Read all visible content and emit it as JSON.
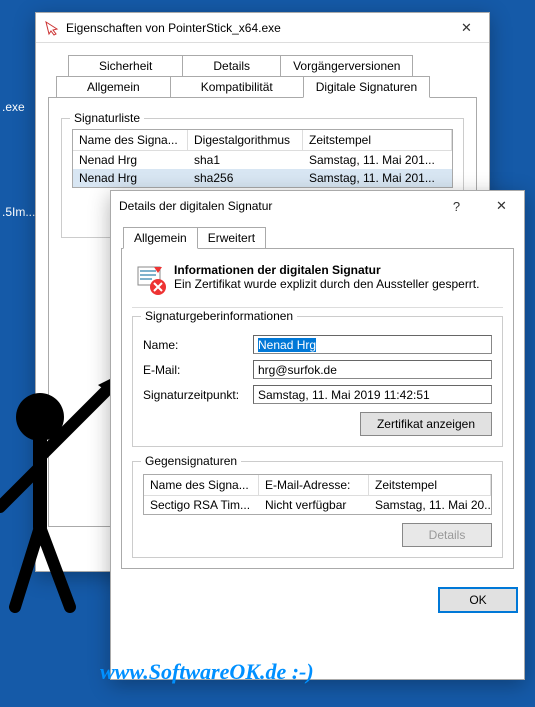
{
  "desktop": {
    "label1": ".exe",
    "label2": ".5Im..."
  },
  "win1": {
    "title": "Eigenschaften von PointerStick_x64.exe",
    "tabs_row1": {
      "t0": "Sicherheit",
      "t1": "Details",
      "t2": "Vorgängerversionen"
    },
    "tabs_row2": {
      "t0": "Allgemein",
      "t1": "Kompatibilität",
      "t2": "Digitale Signaturen"
    },
    "siglist_label": "Signaturliste",
    "cols": {
      "c0": "Name des Signa...",
      "c1": "Digestalgorithmus",
      "c2": "Zeitstempel"
    },
    "rows": {
      "r0": {
        "c0": "Nenad Hrg",
        "c1": "sha1",
        "c2": "Samstag, 11. Mai 201..."
      },
      "r1": {
        "c0": "Nenad Hrg",
        "c1": "sha256",
        "c2": "Samstag, 11. Mai 201..."
      }
    }
  },
  "win2": {
    "title": "Details der digitalen Signatur",
    "tabs": {
      "t0": "Allgemein",
      "t1": "Erweitert"
    },
    "info_title": "Informationen der digitalen Signatur",
    "info_msg": "Ein Zertifikat wurde explizit durch den Aussteller gesperrt.",
    "group1_label": "Signaturgeberinformationen",
    "name_label": "Name:",
    "name_value": "Nenad Hrg",
    "email_label": "E-Mail:",
    "email_value": "hrg@surfok.de",
    "time_label": "Signaturzeitpunkt:",
    "time_value": "Samstag, 11. Mai 2019 11:42:51",
    "view_cert": "Zertifikat anzeigen",
    "group2_label": "Gegensignaturen",
    "cs_cols": {
      "c0": "Name des Signa...",
      "c1": "E-Mail-Adresse:",
      "c2": "Zeitstempel"
    },
    "cs_row": {
      "c0": "Sectigo RSA Tim...",
      "c1": "Nicht verfügbar",
      "c2": "Samstag, 11. Mai 20..."
    },
    "details_btn": "Details",
    "ok": "OK"
  },
  "watermark": "www.SoftwareOK.de :-)"
}
